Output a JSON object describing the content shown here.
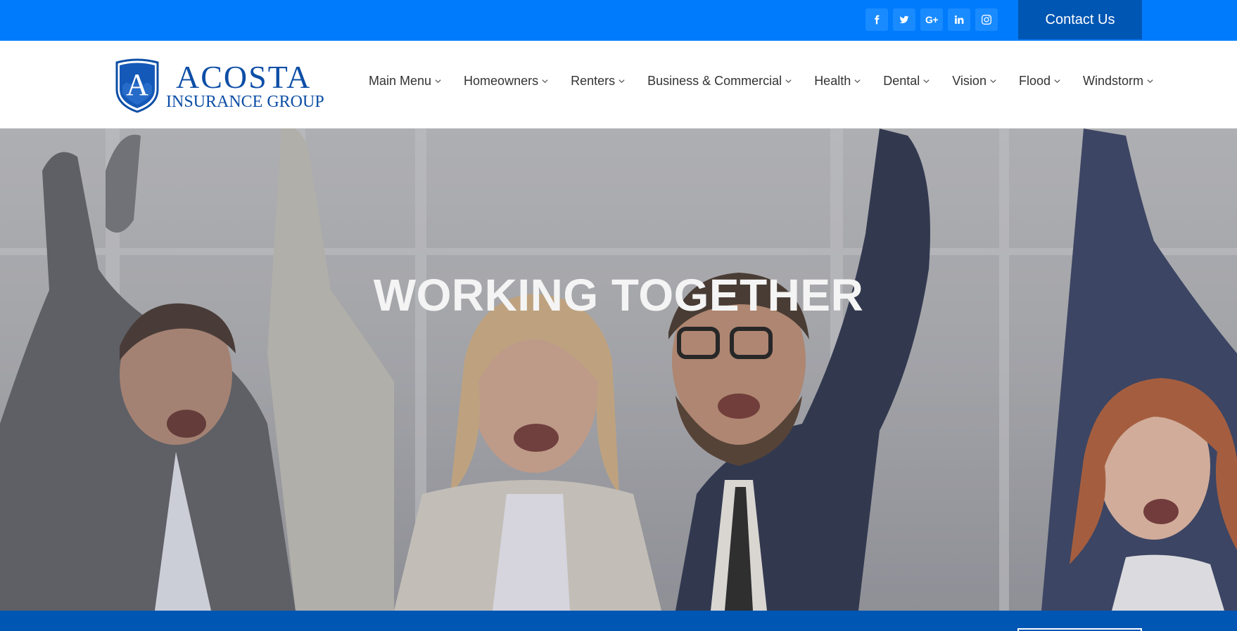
{
  "topbar": {
    "social": [
      {
        "name": "facebook-icon"
      },
      {
        "name": "twitter-icon"
      },
      {
        "name": "google-plus-icon",
        "glyph": "G+"
      },
      {
        "name": "linkedin-icon"
      },
      {
        "name": "instagram-icon"
      }
    ],
    "contact_label": "Contact Us"
  },
  "logo": {
    "letter": "A",
    "name": "ACOSTA",
    "sub": "INSURANCE GROUP"
  },
  "nav": {
    "items": [
      {
        "label": "Main Menu"
      },
      {
        "label": "Homeowners"
      },
      {
        "label": "Renters"
      },
      {
        "label": "Business & Commercial"
      },
      {
        "label": "Health"
      },
      {
        "label": "Dental"
      },
      {
        "label": "Vision"
      },
      {
        "label": "Flood"
      },
      {
        "label": "Windstorm"
      }
    ]
  },
  "hero": {
    "title": "WORKING TOGETHER"
  },
  "colors": {
    "topbar": "#007bfc",
    "contact_button": "#0056b3",
    "brand_blue": "#0d4ea6",
    "bottombar": "#0056b3"
  }
}
